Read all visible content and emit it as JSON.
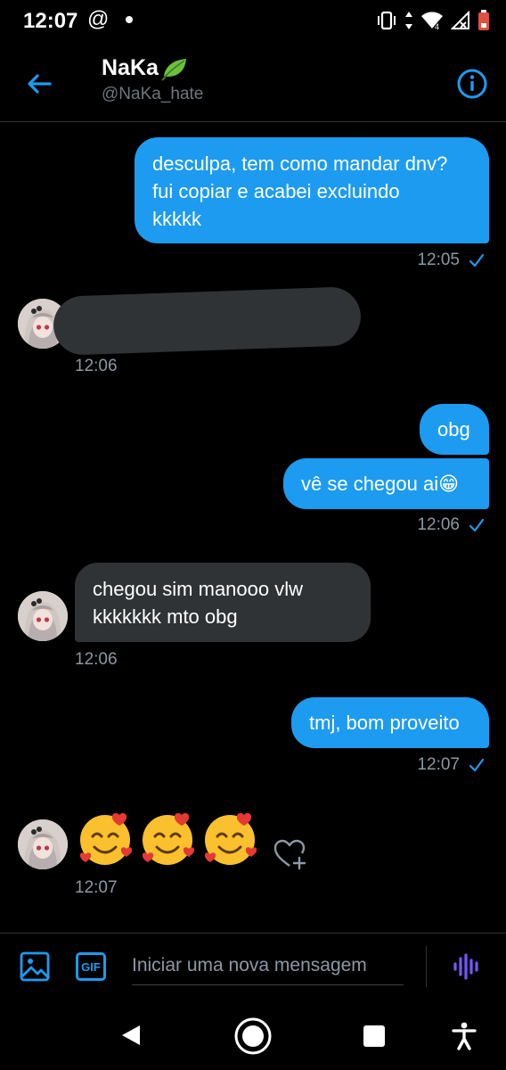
{
  "status_bar": {
    "time": "12:07",
    "notif_symbol": "@"
  },
  "header": {
    "name": "NaKa",
    "handle": "@NaKa_hate",
    "name_emoji_icon": "leaf-icon"
  },
  "messages": [
    {
      "side": "sent",
      "lines": [
        "desculpa, tem como mandar dnv?",
        "fui copiar e acabei excluindo",
        "kkkkk"
      ],
      "time": "12:05"
    },
    {
      "side": "received",
      "redacted": true,
      "time": "12:06"
    },
    {
      "side": "sent",
      "text": "obg"
    },
    {
      "side": "sent",
      "text": "vê se chegou ai😁",
      "time": "12:06"
    },
    {
      "side": "received",
      "lines": [
        "chegou sim manooo vlw",
        "kkkkkkk mto obg"
      ],
      "time": "12:06"
    },
    {
      "side": "sent",
      "text": "tmj, bom proveito",
      "time": "12:07"
    },
    {
      "side": "received",
      "emoji": "🥰🥰🥰",
      "time": "12:07"
    }
  ],
  "composer": {
    "placeholder": "Iniciar uma nova mensagem",
    "gif_label": "GIF"
  },
  "colors": {
    "accent": "#1d9bf0",
    "received_bubble": "#2f3336",
    "voice_icon": "#7856ff"
  }
}
